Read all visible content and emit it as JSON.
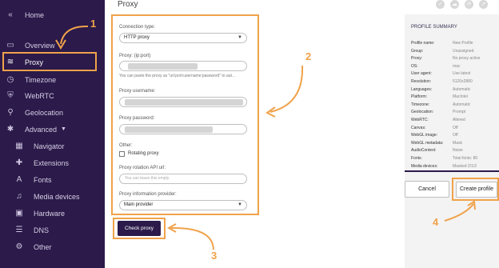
{
  "sidebar": {
    "items": [
      {
        "icon": "chevrons-left-icon",
        "glyph": "«",
        "label": "Home"
      },
      {
        "icon": "overview-card-icon",
        "glyph": "▭",
        "label": "Overview"
      },
      {
        "icon": "wifi-icon",
        "glyph": "≋",
        "label": "Proxy"
      },
      {
        "icon": "clock-icon",
        "glyph": "◷",
        "label": "Timezone"
      },
      {
        "icon": "shield-icon",
        "glyph": "⛨",
        "label": "WebRTC"
      },
      {
        "icon": "location-pin-icon",
        "glyph": "⚲",
        "label": "Geolocation"
      },
      {
        "icon": "asterisk-icon",
        "glyph": "✱",
        "label": "Advanced"
      },
      {
        "icon": "map-icon",
        "glyph": "▦",
        "label": "Navigator"
      },
      {
        "icon": "puzzle-icon",
        "glyph": "✚",
        "label": "Extensions"
      },
      {
        "icon": "font-icon",
        "glyph": "A",
        "label": "Fonts"
      },
      {
        "icon": "headphones-icon",
        "glyph": "♫",
        "label": "Media devices"
      },
      {
        "icon": "chip-icon",
        "glyph": "▣",
        "label": "Hardware"
      },
      {
        "icon": "dns-icon",
        "glyph": "☰",
        "label": "DNS"
      },
      {
        "icon": "gear-icon",
        "glyph": "⚙",
        "label": "Other"
      }
    ]
  },
  "header": {
    "title": "Proxy"
  },
  "form": {
    "connection_type_label": "Connection type:",
    "connection_type_value": "HTTP proxy",
    "proxy_label": "Proxy: (ip:port)",
    "proxy_hint": "You can paste the proxy as \"url:port:username:password\" to aut...",
    "username_label": "Proxy username:",
    "password_label": "Proxy password:",
    "other_label": "Other:",
    "rotating_label": "Rotating proxy",
    "rotation_url_label": "Proxy rotation API url:",
    "rotation_url_placeholder": "You can leave this empty",
    "provider_label": "Proxy information provider:",
    "provider_value": "Main provider",
    "check_button": "Check proxy"
  },
  "summary": {
    "title": "PROFILE SUMMARY",
    "rows": [
      {
        "k": "Profile name:",
        "v": "New Profile"
      },
      {
        "k": "Group:",
        "v": "Unassigned"
      },
      {
        "k": "Proxy:",
        "v": "No proxy active"
      },
      {
        "k": "OS:",
        "v": "mac"
      },
      {
        "k": "User agent:",
        "v": "Use latest"
      },
      {
        "k": "Resolution:",
        "v": "5120x2880"
      },
      {
        "k": "Languages:",
        "v": "Automatic"
      },
      {
        "k": "Platform:",
        "v": "MacIntel"
      },
      {
        "k": "Timezone:",
        "v": "Automatic"
      },
      {
        "k": "Geolocation:",
        "v": "Prompt"
      },
      {
        "k": "WebRTC:",
        "v": "Altered"
      },
      {
        "k": "Canvas:",
        "v": "Off"
      },
      {
        "k": "WebGL image:",
        "v": "Off"
      },
      {
        "k": "WebGL metadata:",
        "v": "Mask"
      },
      {
        "k": "AudioContext:",
        "v": "Noise"
      },
      {
        "k": "Fonts:",
        "v": "Total fonts: 80"
      },
      {
        "k": "Media devices:",
        "v": "Masked 2/1/2"
      }
    ],
    "cancel_button": "Cancel",
    "create_button": "Create profile"
  },
  "annotations": {
    "n1": "1",
    "n2": "2",
    "n3": "3",
    "n4": "4",
    "color": "#f0a24a"
  },
  "colors": {
    "sidebar_bg": "#2b1a4a",
    "accent": "#f0a24a"
  }
}
